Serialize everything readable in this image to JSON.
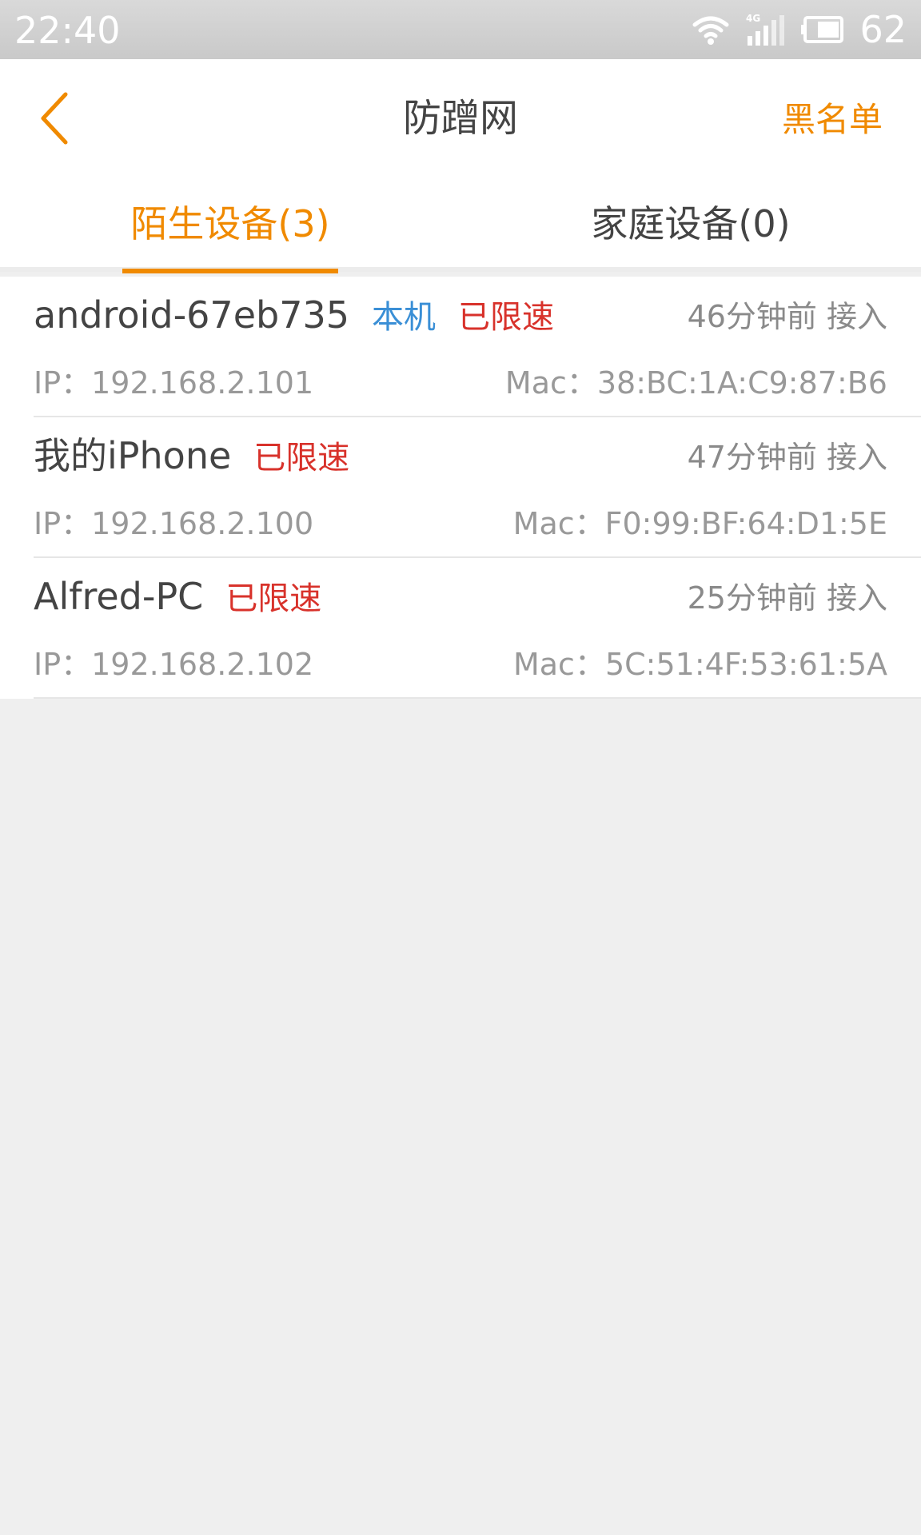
{
  "status_bar": {
    "time": "22:40",
    "battery": "62",
    "network": "4G"
  },
  "header": {
    "title": "防蹭网",
    "blacklist_label": "黑名单",
    "accent_color": "#f08a00"
  },
  "tabs": [
    {
      "label": "陌生设备(3)",
      "selected": true
    },
    {
      "label": "家庭设备(0)",
      "selected": false
    }
  ],
  "devices": [
    {
      "name": "android-67eb735",
      "self_tag": "本机",
      "limit_tag": "已限速",
      "time": "46分钟前 接入",
      "ip": "IP：192.168.2.101",
      "mac": "Mac：38:BC:1A:C9:87:B6"
    },
    {
      "name": "我的iPhone",
      "limit_tag": "已限速",
      "time": "47分钟前 接入",
      "ip": "IP：192.168.2.100",
      "mac": "Mac：F0:99:BF:64:D1:5E"
    },
    {
      "name": "Alfred-PC",
      "limit_tag": "已限速",
      "time": "25分钟前 接入",
      "ip": "IP：192.168.2.102",
      "mac": "Mac：5C:51:4F:53:61:5A"
    }
  ]
}
